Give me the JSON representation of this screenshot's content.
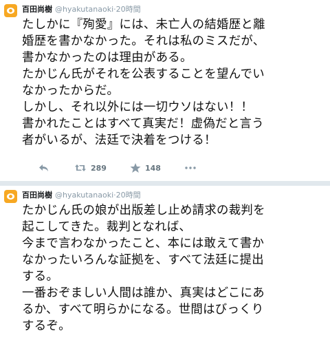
{
  "tweets": [
    {
      "name": "百田尚樹",
      "handle": "@hyakutanaoki",
      "separator": "·",
      "time": "20時間",
      "text": "たしかに『殉愛』には、未亡人の結婚歴と離\n婚歴を書かなかった。それは私のミスだが、\n書かなかったのは理由がある。\nたかじん氏がそれを公表することを望んでい\nなかったからだ。\nしかし、それ以外には一切ウソはない！！\n書かれたことはすべて真実だ！虚偽だと言う\n者がいるが、法廷で決着をつける！",
      "actions": {
        "reply_icon": "reply-icon",
        "retweet_icon": "retweet-icon",
        "retweet_count": "289",
        "favorite_icon": "star-icon",
        "favorite_count": "148",
        "more_icon": "more-icon"
      }
    },
    {
      "name": "百田尚樹",
      "handle": "@hyakutanaoki",
      "separator": "·",
      "time": "20時間",
      "text": "たかじん氏の娘が出版差し止め請求の裁判を\n起こしてきた。裁判となれば、\n今まで言わなかったこと、本には敢えて書か\nなかったいろんな証拠を、すべて法廷に提出\nする。\n一番おぞましい人間は誰か、真実はどこにあ\nるか、すべて明らかになる。世間はびっくり\nするぞ。"
    }
  ],
  "colors": {
    "avatar": "#f7a823",
    "muted": "#8899a6",
    "divider": "#e1e8ed"
  }
}
